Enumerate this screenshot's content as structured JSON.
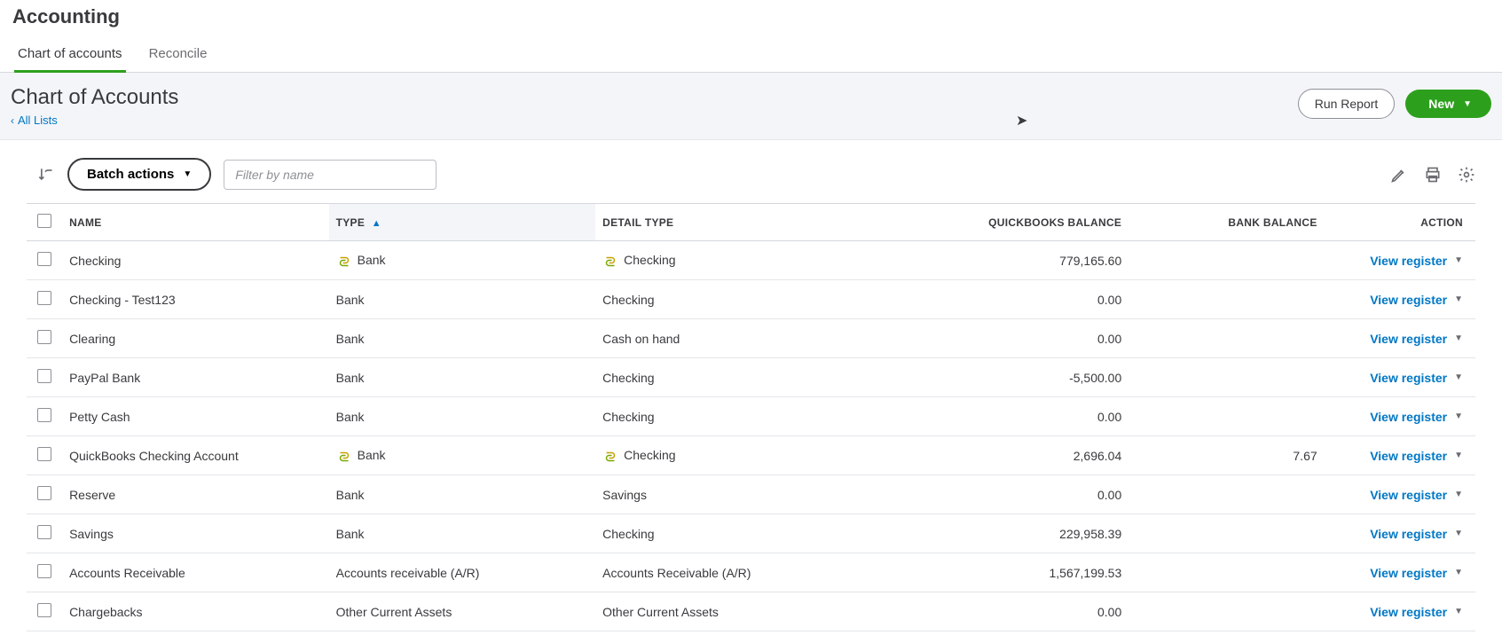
{
  "app": {
    "title": "Accounting"
  },
  "tabs": [
    {
      "label": "Chart of accounts",
      "active": true
    },
    {
      "label": "Reconcile",
      "active": false
    }
  ],
  "subheader": {
    "title": "Chart of Accounts",
    "back_label": "All Lists",
    "run_report": "Run Report",
    "new_button": "New"
  },
  "toolbar": {
    "batch_label": "Batch actions",
    "filter_placeholder": "Filter by name"
  },
  "columns": {
    "name": "NAME",
    "type": "TYPE",
    "detail": "DETAIL TYPE",
    "qb": "QUICKBOOKS BALANCE",
    "bank": "BANK BALANCE",
    "action": "ACTION"
  },
  "action_label": "View register",
  "rows": [
    {
      "name": "Checking",
      "type": "Bank",
      "detail": "Checking",
      "qb": "779,165.60",
      "bank": "",
      "linkedType": true,
      "linkedDetail": true
    },
    {
      "name": "Checking - Test123",
      "type": "Bank",
      "detail": "Checking",
      "qb": "0.00",
      "bank": "",
      "linkedType": false,
      "linkedDetail": false
    },
    {
      "name": "Clearing",
      "type": "Bank",
      "detail": "Cash on hand",
      "qb": "0.00",
      "bank": "",
      "linkedType": false,
      "linkedDetail": false
    },
    {
      "name": "PayPal Bank",
      "type": "Bank",
      "detail": "Checking",
      "qb": "-5,500.00",
      "bank": "",
      "linkedType": false,
      "linkedDetail": false
    },
    {
      "name": "Petty Cash",
      "type": "Bank",
      "detail": "Checking",
      "qb": "0.00",
      "bank": "",
      "linkedType": false,
      "linkedDetail": false
    },
    {
      "name": "QuickBooks Checking Account",
      "type": "Bank",
      "detail": "Checking",
      "qb": "2,696.04",
      "bank": "7.67",
      "linkedType": true,
      "linkedDetail": true
    },
    {
      "name": "Reserve",
      "type": "Bank",
      "detail": "Savings",
      "qb": "0.00",
      "bank": "",
      "linkedType": false,
      "linkedDetail": false
    },
    {
      "name": "Savings",
      "type": "Bank",
      "detail": "Checking",
      "qb": "229,958.39",
      "bank": "",
      "linkedType": false,
      "linkedDetail": false
    },
    {
      "name": "Accounts Receivable",
      "type": "Accounts receivable (A/R)",
      "detail": "Accounts Receivable (A/R)",
      "qb": "1,567,199.53",
      "bank": "",
      "linkedType": false,
      "linkedDetail": false
    },
    {
      "name": "Chargebacks",
      "type": "Other Current Assets",
      "detail": "Other Current Assets",
      "qb": "0.00",
      "bank": "",
      "linkedType": false,
      "linkedDetail": false
    }
  ]
}
